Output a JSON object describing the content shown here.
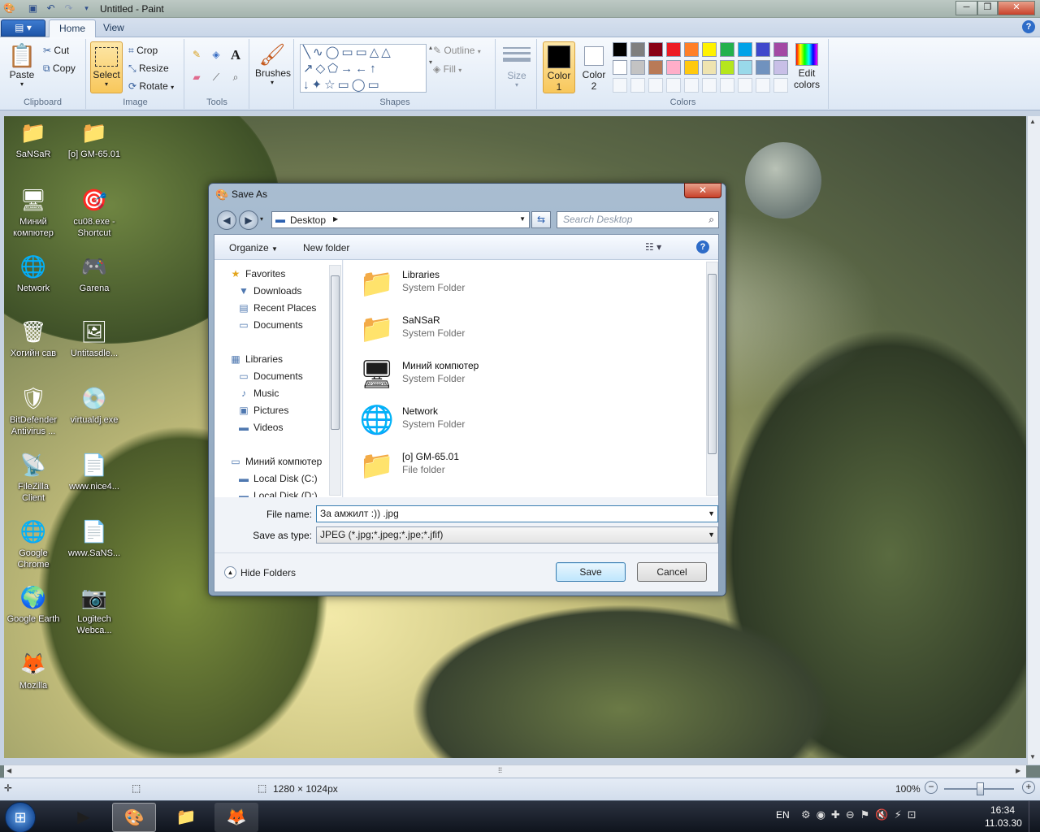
{
  "window": {
    "title": "Untitled - Paint",
    "minimize": "─",
    "maximize": "❐",
    "close": "✕"
  },
  "tabs": [
    {
      "label": "Home"
    },
    {
      "label": "View"
    }
  ],
  "ribbon": {
    "clipboard": {
      "paste": "Paste",
      "cut": "Cut",
      "copy": "Copy",
      "label": "Clipboard"
    },
    "image": {
      "select": "Select",
      "crop": "Crop",
      "resize": "Resize",
      "rotate": "Rotate",
      "label": "Image"
    },
    "tools": {
      "label": "Tools"
    },
    "brushes": {
      "label": "Brushes"
    },
    "shapes": {
      "outline": "Outline",
      "fill": "Fill",
      "label": "Shapes"
    },
    "size": {
      "label": "Size"
    },
    "colors": {
      "color1_label": "Color",
      "color1_num": "1",
      "color2_label": "Color",
      "color2_num": "2",
      "edit": "Edit",
      "edit2": "colors",
      "label": "Colors",
      "color1": "#000000",
      "color2": "#ffffff",
      "palette_row1": [
        "#000000",
        "#7f7f7f",
        "#880015",
        "#ed1c24",
        "#ff7f27",
        "#fff200",
        "#22b14c",
        "#00a2e8",
        "#3f48cc",
        "#a349a4"
      ],
      "palette_row2": [
        "#ffffff",
        "#c3c3c3",
        "#b97a57",
        "#ffaec9",
        "#ffc90e",
        "#efe4b0",
        "#b5e61d",
        "#99d9ea",
        "#7092be",
        "#c8bfe7"
      ]
    }
  },
  "desktop_icons": [
    {
      "label": "SaNSaR",
      "label2": "",
      "icon": "user-folder-icon",
      "glyph": "📁"
    },
    {
      "label": "[o] GM-65.01",
      "label2": "",
      "icon": "folder-icon",
      "glyph": "📁"
    },
    {
      "label": "Миний",
      "label2": "компютер",
      "icon": "computer-icon",
      "glyph": "🖥"
    },
    {
      "label": "cu08.exe -",
      "label2": "Shortcut",
      "icon": "cs-shortcut-icon",
      "glyph": "🎯"
    },
    {
      "label": "Network",
      "label2": "",
      "icon": "network-icon",
      "glyph": "🌐"
    },
    {
      "label": "Garena",
      "label2": "",
      "icon": "garena-icon",
      "glyph": "🎮"
    },
    {
      "label": "Хогийн сав",
      "label2": "",
      "icon": "recycle-bin-icon",
      "glyph": "🗑"
    },
    {
      "label": "Untitasdle...",
      "label2": "",
      "icon": "image-file-icon",
      "glyph": "🖼"
    },
    {
      "label": "BitDefender",
      "label2": "Antivirus ...",
      "icon": "bitdefender-icon",
      "glyph": "🛡"
    },
    {
      "label": "virtualdj.exe",
      "label2": "",
      "icon": "virtualdj-icon",
      "glyph": "💿"
    },
    {
      "label": "FileZilla",
      "label2": "Client",
      "icon": "filezilla-icon",
      "glyph": "📡"
    },
    {
      "label": "www.nice4...",
      "label2": "",
      "icon": "shortcut-file-icon",
      "glyph": "📄"
    },
    {
      "label": "Google",
      "label2": "Chrome",
      "icon": "chrome-icon",
      "glyph": "🌐"
    },
    {
      "label": "www.SaNS...",
      "label2": "",
      "icon": "shortcut-file-icon",
      "glyph": "📄"
    },
    {
      "label": "Google Earth",
      "label2": "",
      "icon": "google-earth-icon",
      "glyph": "🌍"
    },
    {
      "label": "Logitech",
      "label2": "Webca...",
      "icon": "webcam-icon",
      "glyph": "📷"
    },
    {
      "label": "Mozilla",
      "label2": "",
      "icon": "firefox-icon",
      "glyph": "🦊"
    }
  ],
  "dialog": {
    "title": "Save As",
    "close": "✕",
    "address": "Desktop",
    "search_placeholder": "Search Desktop",
    "organize": "Organize",
    "new_folder": "New folder",
    "help": "?",
    "nav": [
      {
        "label": "Favorites",
        "icon": "star-icon",
        "glyph": "★"
      },
      {
        "label": "Downloads",
        "icon": "downloads-folder-icon",
        "glyph": "▼"
      },
      {
        "label": "Recent Places",
        "icon": "recent-places-icon",
        "glyph": "▤"
      },
      {
        "label": "Documents",
        "icon": "documents-icon",
        "glyph": "▭"
      },
      {
        "label": "Libraries",
        "icon": "libraries-icon",
        "glyph": "▦"
      },
      {
        "label": "Documents",
        "icon": "documents-icon",
        "glyph": "▭"
      },
      {
        "label": "Music",
        "icon": "music-icon",
        "glyph": "♪"
      },
      {
        "label": "Pictures",
        "icon": "pictures-icon",
        "glyph": "▣"
      },
      {
        "label": "Videos",
        "icon": "videos-icon",
        "glyph": "▬"
      },
      {
        "label": "Миний компютер",
        "icon": "computer-icon",
        "glyph": "▭"
      },
      {
        "label": "Local Disk (C:)",
        "icon": "disk-icon",
        "glyph": "▬"
      },
      {
        "label": "Local Disk (D:)",
        "icon": "disk-icon",
        "glyph": "▬"
      }
    ],
    "files": [
      {
        "name": "Libraries",
        "type": "System Folder",
        "icon": "libraries-folder-icon",
        "glyph": "📁"
      },
      {
        "name": "SaNSaR",
        "type": "System Folder",
        "icon": "user-folder-icon",
        "glyph": "📁"
      },
      {
        "name": "Миний компютер",
        "type": "System Folder",
        "icon": "computer-icon",
        "glyph": "🖥"
      },
      {
        "name": "Network",
        "type": "System Folder",
        "icon": "network-icon",
        "glyph": "🌐"
      },
      {
        "name": "[o] GM-65.01",
        "type": "File folder",
        "icon": "folder-icon",
        "glyph": "📁"
      }
    ],
    "file_name_label": "File name:",
    "file_name": "За амжилт :)) .jpg",
    "save_type_label": "Save as type:",
    "save_type": "JPEG (*.jpg;*.jpeg;*.jpe;*.jfif)",
    "hide_folders": "Hide Folders",
    "save": "Save",
    "cancel": "Cancel"
  },
  "statusbar": {
    "dimensions": "1280 × 1024px",
    "zoom": "100%"
  },
  "taskbar": {
    "lang": "EN",
    "time": "16:34",
    "date": "11.03.30"
  }
}
